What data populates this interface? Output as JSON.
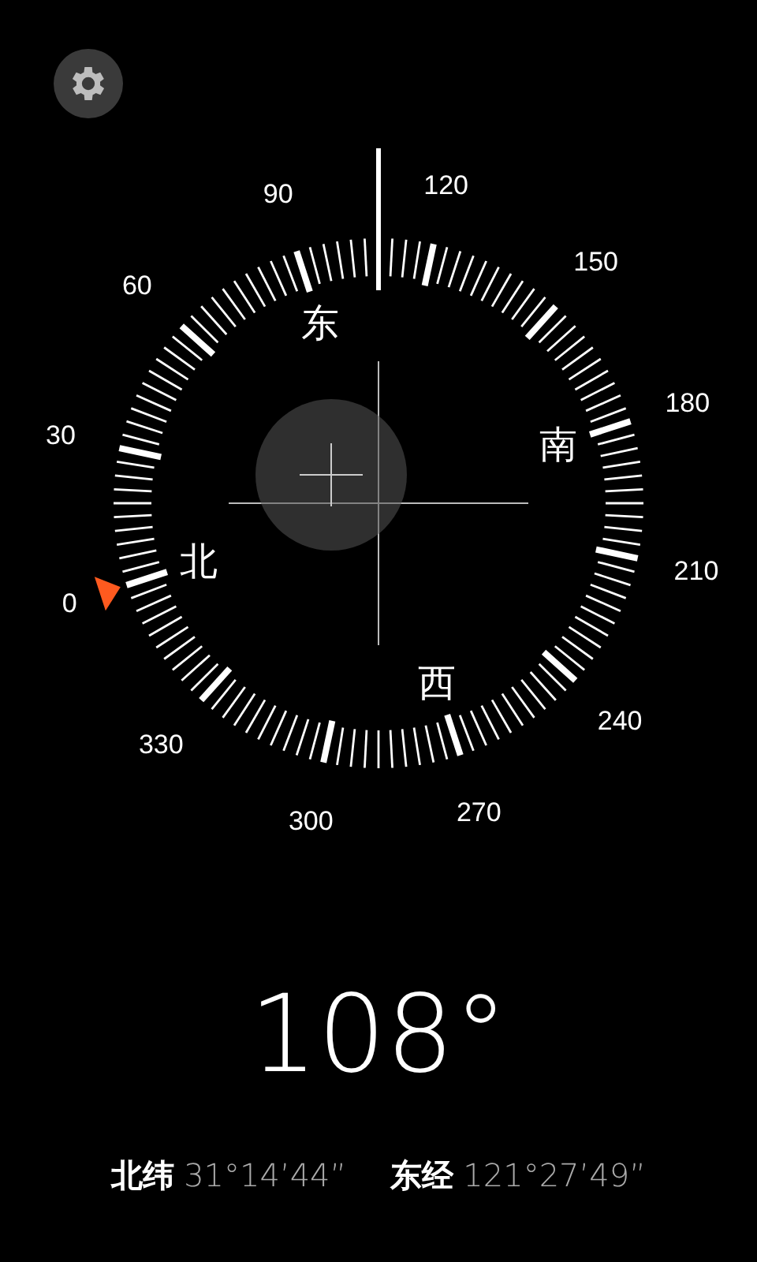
{
  "dial": {
    "degree_labels": [
      "0",
      "30",
      "60",
      "90",
      "120",
      "150",
      "180",
      "210",
      "240",
      "270",
      "300",
      "330"
    ],
    "cardinal_labels": [
      "北",
      "东",
      "南",
      "西"
    ]
  },
  "heading": "108°",
  "coordinates": [
    {
      "label": "北纬",
      "value": "31°14’44”"
    },
    {
      "label": "东经",
      "value": "121°27’49”"
    }
  ]
}
